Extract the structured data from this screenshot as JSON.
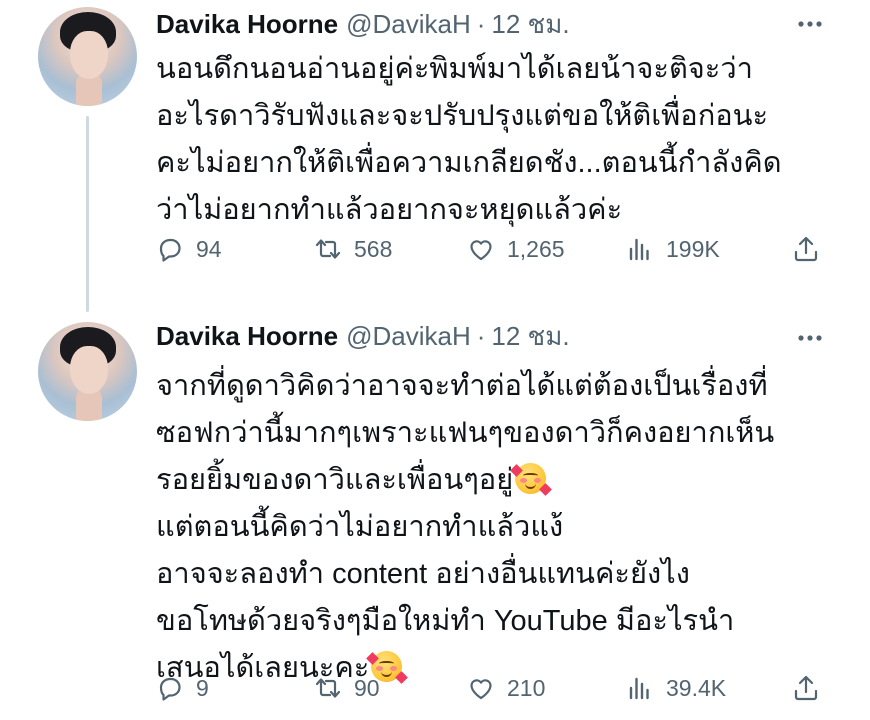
{
  "tweets": [
    {
      "author": {
        "name": "Davika Hoorne",
        "handle": "@DavikaH"
      },
      "separator": "·",
      "time": "12 ชม.",
      "lines": [
        "นอนดึกนอนอ่านอยู่ค่ะพิมพ์มาได้เลยน้าจะติจะว่า",
        "อะไรดาวิรับฟังและจะปรับปรุงแต่ขอให้ติเพื่อก่อนะ",
        "คะไม่อยากให้ติเพื่อความเกลียดชัง...ตอนนี้กำลังคิด",
        "ว่าไม่อยากทำแล้วอยากจะหยุดแล้วค่ะ"
      ],
      "stats": {
        "replies": "94",
        "retweets": "568",
        "likes": "1,265",
        "views": "199K"
      }
    },
    {
      "author": {
        "name": "Davika Hoorne",
        "handle": "@DavikaH"
      },
      "separator": "·",
      "time": "12 ชม.",
      "lines": [
        "จากที่ดูดาวิคิดว่าอาจจะทำต่อได้แต่ต้องเป็นเรื่องที่",
        "ซอฟกว่านี้มากๆเพราะแฟนๆของดาวิก็คงอยากเห็น",
        "รอยยิ้มของดาวิและเพื่อนๆอยู่",
        "แต่ตอนนี้คิดว่าไม่อยากทำแล้วแง้",
        "อาจจะลองทำ content อย่างอื่นแทนค่ะยังไง",
        "ขอโทษด้วยจริงๆมือใหม่ทำ YouTube มีอะไรนำ",
        "เสนอได้เลยนะคะ"
      ],
      "stats": {
        "replies": "9",
        "retweets": "90",
        "likes": "210",
        "views": "39.4K"
      }
    }
  ],
  "emoji": "smiling-face-with-hearts",
  "colors": {
    "text": "#0f1419",
    "secondary": "#536471",
    "thread_line": "#cfd9de",
    "background": "#ffffff"
  }
}
